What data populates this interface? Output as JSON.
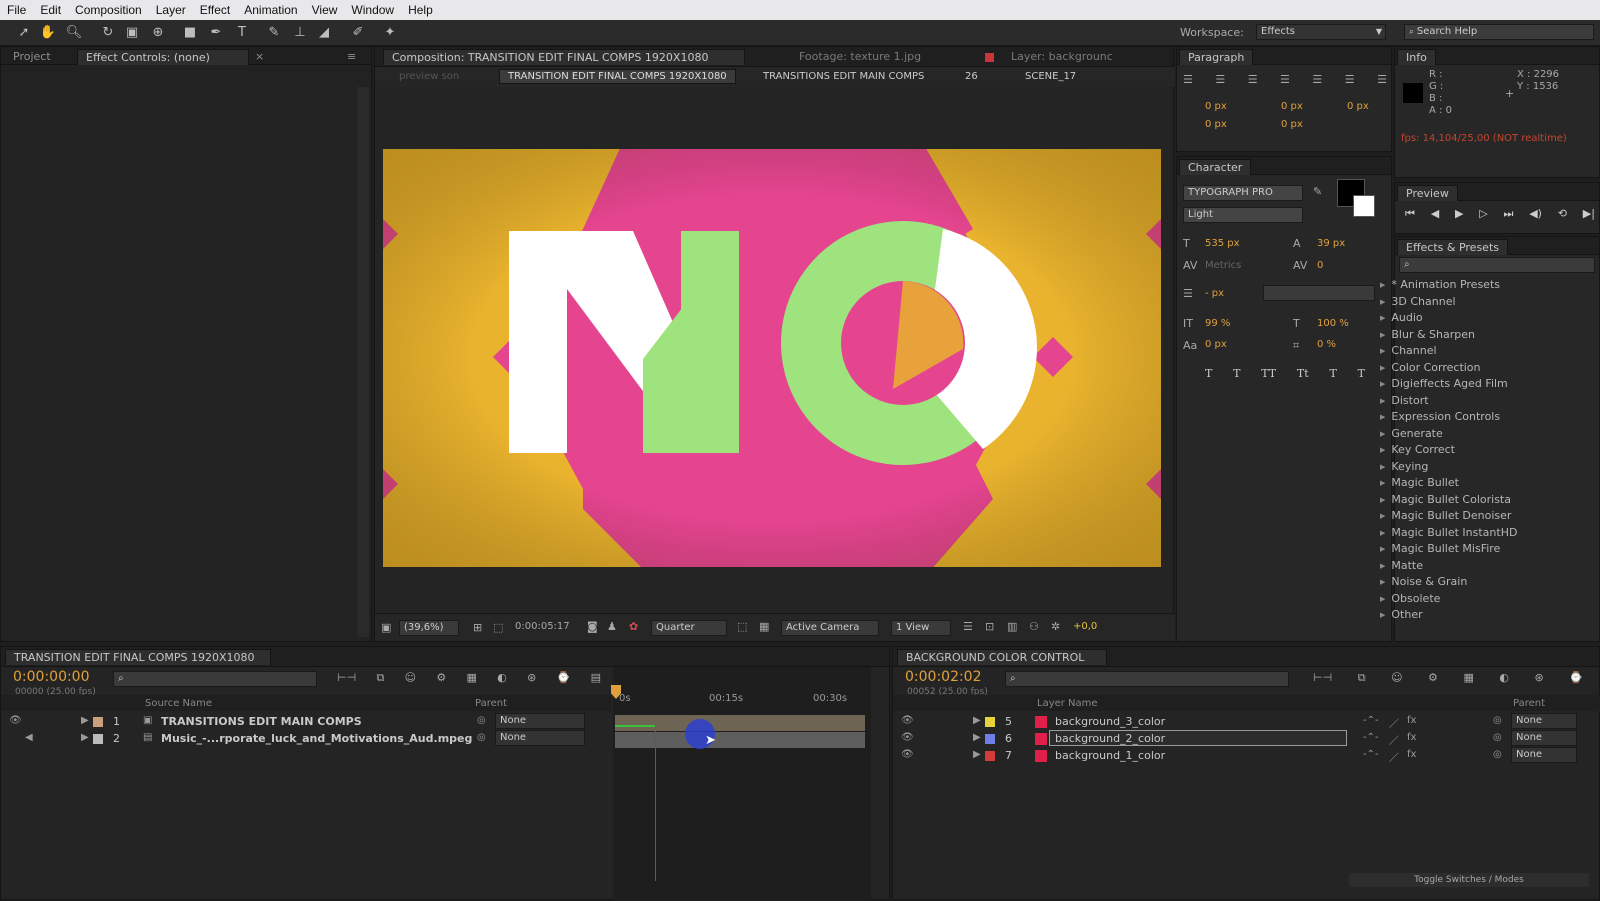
{
  "menu": [
    "File",
    "Edit",
    "Composition",
    "Layer",
    "Effect",
    "Animation",
    "View",
    "Window",
    "Help"
  ],
  "toolbar": {
    "workspace_label": "Workspace:",
    "workspace_value": "Effects",
    "search_placeholder": "Search Help"
  },
  "project_panel": {
    "tab_project": "Project",
    "tab_effect_controls": "Effect Controls: (none)"
  },
  "composition_panel": {
    "tab_composition": "Composition: TRANSITION EDIT FINAL COMPS 1920X1080",
    "tab_footage": "Footage: texture 1.jpg",
    "tab_layer": "Layer: backgrounc",
    "preview_label": "preview son",
    "breadcrumbs": [
      "TRANSITION EDIT FINAL COMPS 1920X1080",
      "TRANSITIONS EDIT MAIN COMPS",
      "26",
      "SCENE_17"
    ],
    "viewer_text": "NO",
    "bottom": {
      "zoom": "(39,6%)",
      "timecode": "0:00:05:17",
      "resolution": "Quarter",
      "camera": "Active Camera",
      "views": "1 View",
      "exposure": "+0,0"
    },
    "colors": {
      "yellow": "#e9b32d",
      "pink": "#e5458f",
      "green": "#9ee37e",
      "white": "#ffffff"
    }
  },
  "paragraph_panel": {
    "tab": "Paragraph",
    "indents": [
      "0 px",
      "0 px",
      "0 px",
      "0 px",
      "0 px"
    ]
  },
  "character_panel": {
    "tab": "Character",
    "font": "TYPOGRAPH PRO",
    "style": "Light",
    "font_size": "535 px",
    "leading": "39 px",
    "kerning": "Metrics",
    "tracking": "0",
    "line_px": "- px",
    "vscale": "99 %",
    "hscale": "100 %",
    "baseline": "0 px",
    "tsume": "0 %",
    "style_buttons": [
      "T",
      "T",
      "TT",
      "Tt",
      "T",
      "T"
    ]
  },
  "info_panel": {
    "tab": "Info",
    "r": "R :",
    "g": "G :",
    "b": "B :",
    "a": "A : 0",
    "x": "X : 2296",
    "y": "Y : 1536",
    "fps": "fps: 14,104/25,00 (NOT realtime)"
  },
  "preview_panel": {
    "tab": "Preview"
  },
  "effects_panel": {
    "tab": "Effects & Presets",
    "items": [
      "* Animation Presets",
      "3D Channel",
      "Audio",
      "Blur & Sharpen",
      "Channel",
      "Color Correction",
      "Digieffects Aged Film",
      "Distort",
      "Expression Controls",
      "Generate",
      "Key Correct",
      "Keying",
      "Magic Bullet",
      "Magic Bullet Colorista",
      "Magic Bullet Denoiser",
      "Magic Bullet InstantHD",
      "Magic Bullet MisFire",
      "Matte",
      "Noise & Grain",
      "Obsolete",
      "Other"
    ]
  },
  "timeline_left": {
    "tab": "TRANSITION EDIT FINAL COMPS 1920X1080",
    "timecode": "0:00:00:00",
    "frames": "00000 (25.00 fps)",
    "col_source": "Source Name",
    "col_parent": "Parent",
    "ruler": [
      "0s",
      "00:15s",
      "00:30s"
    ],
    "layers": [
      {
        "num": "1",
        "name": "TRANSITIONS EDIT MAIN COMPS",
        "parent": "None",
        "color": "#c8a07c"
      },
      {
        "num": "2",
        "name": "Music_-...rporate_luck_and_Motivations_Aud.mpeg",
        "parent": "None",
        "color": "#bcbcbc"
      }
    ]
  },
  "timeline_right": {
    "tab": "BACKGROUND COLOR CONTROL",
    "timecode": "0:00:02:02",
    "frames": "00052 (25.00 fps)",
    "col_layer": "Layer Name",
    "col_parent": "Parent",
    "layers": [
      {
        "num": "5",
        "name": "background_3_color",
        "parent": "None",
        "label_color": "#e8d23a",
        "swatch": "#e0204a"
      },
      {
        "num": "6",
        "name": "background_2_color",
        "parent": "None",
        "label_color": "#6f7fe8",
        "swatch": "#e0204a"
      },
      {
        "num": "7",
        "name": "background_1_color",
        "parent": "None",
        "label_color": "#d63a3a",
        "swatch": "#e0204a"
      }
    ],
    "toggle_label": "Toggle Switches / Modes"
  }
}
